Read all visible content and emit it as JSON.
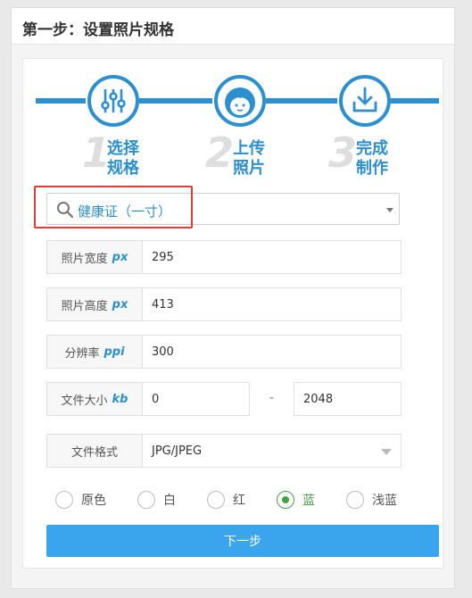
{
  "page": {
    "title": "第一步：设置照片规格"
  },
  "steps": [
    {
      "num": "1",
      "line1": "选择",
      "line2": "规格",
      "icon": "sliders-icon"
    },
    {
      "num": "2",
      "line1": "上传",
      "line2": "照片",
      "icon": "face-icon"
    },
    {
      "num": "3",
      "line1": "完成",
      "line2": "制作",
      "icon": "download-icon"
    }
  ],
  "spec_select": {
    "value": "健康证（一寸）"
  },
  "fields": {
    "width": {
      "label": "照片宽度",
      "unit": "px",
      "value": "295"
    },
    "height": {
      "label": "照片高度",
      "unit": "px",
      "value": "413"
    },
    "dpi": {
      "label": "分辨率",
      "unit": "ppi",
      "value": "300"
    },
    "size": {
      "label": "文件大小",
      "unit": "kb",
      "min": "0",
      "separator": "-",
      "max": "2048"
    },
    "format": {
      "label": "文件格式",
      "value": "JPG/JPEG"
    }
  },
  "bg_colors": [
    {
      "label": "原色",
      "selected": false
    },
    {
      "label": "白",
      "selected": false
    },
    {
      "label": "红",
      "selected": false
    },
    {
      "label": "蓝",
      "selected": true
    },
    {
      "label": "浅蓝",
      "selected": false
    }
  ],
  "next_button": {
    "label": "下一步"
  },
  "colors": {
    "accent": "#2b8fd0",
    "button": "#3aa5ec",
    "selected": "#43a047",
    "highlight": "#e53935"
  }
}
